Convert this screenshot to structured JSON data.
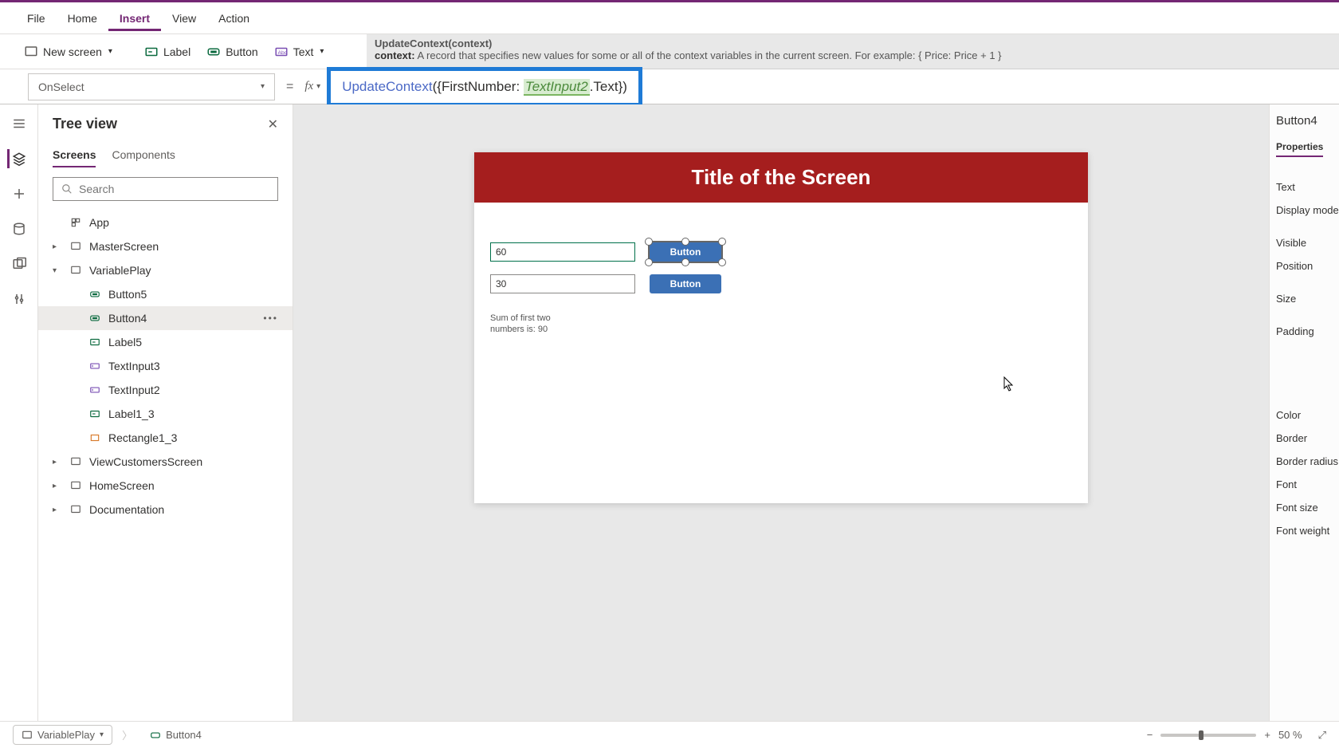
{
  "menu": {
    "file": "File",
    "home": "Home",
    "insert": "Insert",
    "view": "View",
    "action": "Action"
  },
  "toolbar": {
    "new_screen": "New screen",
    "label": "Label",
    "button": "Button",
    "text": "Text"
  },
  "formula_hint": {
    "title": "UpdateContext",
    "title_arg": "context",
    "label": "context:",
    "desc": "A record that specifies new values for some or all of the context variables in the current screen. For example: { Price: Price + 1 }"
  },
  "property_select": "OnSelect",
  "formula": {
    "fn": "UpdateContext",
    "open": "({FirstNumber: ",
    "highlight": "TextInput2",
    "close": ".Text})"
  },
  "autocomplete": "TextInput2",
  "tree": {
    "title": "Tree view",
    "tab_screens": "Screens",
    "tab_components": "Components",
    "search_placeholder": "Search",
    "app": "App",
    "items": [
      {
        "name": "MasterScreen",
        "level": 1,
        "hasChildren": true,
        "expanded": false,
        "icon": "screen"
      },
      {
        "name": "VariablePlay",
        "level": 1,
        "hasChildren": true,
        "expanded": true,
        "icon": "screen"
      },
      {
        "name": "Button5",
        "level": 2,
        "icon": "button"
      },
      {
        "name": "Button4",
        "level": 2,
        "icon": "button",
        "selected": true
      },
      {
        "name": "Label5",
        "level": 2,
        "icon": "label"
      },
      {
        "name": "TextInput3",
        "level": 2,
        "icon": "textinput"
      },
      {
        "name": "TextInput2",
        "level": 2,
        "icon": "textinput"
      },
      {
        "name": "Label1_3",
        "level": 2,
        "icon": "label"
      },
      {
        "name": "Rectangle1_3",
        "level": 2,
        "icon": "rect"
      },
      {
        "name": "ViewCustomersScreen",
        "level": 1,
        "hasChildren": true,
        "expanded": false,
        "icon": "screen"
      },
      {
        "name": "HomeScreen",
        "level": 1,
        "hasChildren": true,
        "expanded": false,
        "icon": "screen"
      },
      {
        "name": "Documentation",
        "level": 1,
        "hasChildren": true,
        "expanded": false,
        "icon": "screen"
      }
    ]
  },
  "canvas": {
    "title": "Title of the Screen",
    "input1": "60",
    "input2": "30",
    "button1": "Button",
    "button2": "Button",
    "sum_label": "Sum of first two numbers is: 90"
  },
  "right": {
    "selected": "Button4",
    "tab": "Properties",
    "props": [
      "Text",
      "Display mode",
      "Visible",
      "Position",
      "Size",
      "Padding",
      "Color",
      "Border",
      "Border radius",
      "Font",
      "Font size",
      "Font weight"
    ]
  },
  "status": {
    "crumb_screen": "VariablePlay",
    "crumb_ctrl": "Button4",
    "zoom": "50",
    "zoom_unit": "%"
  }
}
